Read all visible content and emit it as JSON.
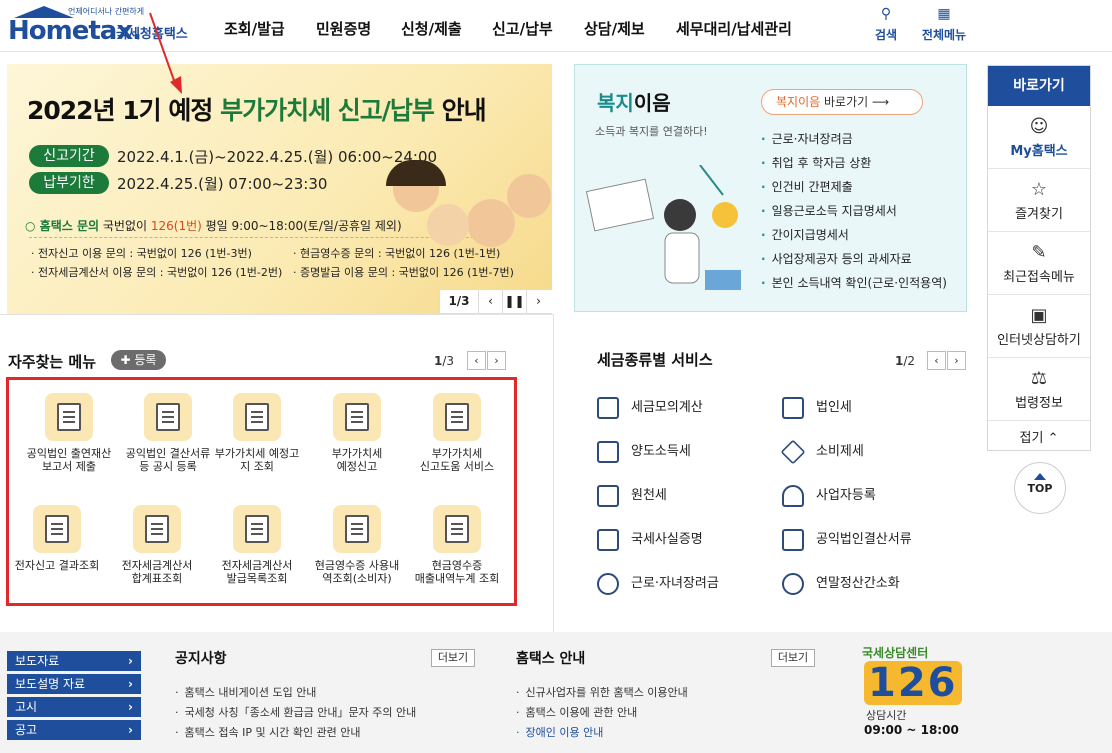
{
  "header": {
    "logo_main": "Hometax.",
    "logo_sub": "국세청홈택스",
    "logo_tiny": "언제어디서나 간편하게",
    "nav": [
      "조회/발급",
      "민원증명",
      "신청/제출",
      "신고/납부",
      "상담/제보",
      "세무대리/납세관리"
    ],
    "search_label": "검색",
    "allmenu_label": "전체메뉴"
  },
  "banner": {
    "title_prefix": "2022년 1기 예정 ",
    "title_highlight": "부가가치세 신고/납부",
    "title_suffix": " 안내",
    "period_label": "신고기간",
    "period_text": "2022.4.1.(금)~2022.4.25.(월) 06:00~24:00",
    "pay_label": "납부기한",
    "pay_text": "2022.4.25.(월) 07:00~23:30",
    "contact_brand": "홈택스 문의",
    "contact_a": "국번없이 ",
    "contact_num": "126(1번)",
    "contact_b": " 평일 9:00~18:00(토/일/공휴일 제외)",
    "line1_left": "· 전자신고 이용 문의 : 국번없이 126 (1번-3번)",
    "line1_right": "· 현금영수증 문의 : 국번없이 126 (1번-1번)",
    "line2_left": "· 전자세금계산서 이용 문의 : 국번없이 126 (1번-2번)",
    "line2_right": "· 증명발급 이용 문의 : 국번없이 126 (1번-7번)",
    "pager": "1/3"
  },
  "welfare": {
    "title_a": "복지",
    "title_b": "이음",
    "subtitle": "소득과 복지를 연결하다!",
    "go_a": "복지이음",
    "go_b": " 바로가기",
    "items": [
      "근로·자녀장려금",
      "취업 후 학자금 상환",
      "인건비 간편제출",
      "일용근로소득 지급명세서",
      "간이지급명세서",
      "사업장제공자 등의 과세자료",
      "본인 소득내역 확인(근로·인적용역)"
    ]
  },
  "quick": {
    "title": "바로가기",
    "items": [
      "My홈택스",
      "즐겨찾기",
      "최근접속메뉴",
      "인터넷상담하기",
      "법령정보"
    ],
    "fold": "접기",
    "top": "TOP"
  },
  "freq": {
    "title": "자주찾는 메뉴",
    "register": "등록",
    "pager_cur": "1",
    "pager_total": "/3",
    "items": [
      [
        "공익법인 출연재산",
        "보고서 제출"
      ],
      [
        "공익법인 결산서류",
        "등 공시 등록"
      ],
      [
        "부가가치세 예정고",
        "지 조회"
      ],
      [
        "부가가치세",
        "예정신고"
      ],
      [
        "부가가치세",
        "신고도움 서비스"
      ],
      [
        "전자신고 결과조회",
        ""
      ],
      [
        "전자세금계산서",
        "합계표조회"
      ],
      [
        "전자세금계산서",
        "발급목록조회"
      ],
      [
        "현금영수증 사용내",
        "역조회(소비자)"
      ],
      [
        "현금영수증",
        "매출내역누계 조회"
      ]
    ]
  },
  "tax": {
    "title": "세금종류별 서비스",
    "pager_cur": "1",
    "pager_total": "/2",
    "left": [
      "세금모의계산",
      "양도소득세",
      "원천세",
      "국세사실증명",
      "근로·자녀장려금"
    ],
    "right": [
      "법인세",
      "소비제세",
      "사업자등록",
      "공익법인결산서류",
      "연말정산간소화"
    ]
  },
  "footer": {
    "side_buttons": [
      "보도자료",
      "보도설명 자료",
      "고시",
      "공고"
    ],
    "notice_title": "공지사항",
    "notice_more": "더보기",
    "notice_items": [
      "홈택스 내비게이션 도입 안내",
      "국세청 사칭「종소세 환급금 안내」문자 주의 안내",
      "홈택스 접속 IP 및 시간 확인 관련 안내"
    ],
    "guide_title": "홈택스 안내",
    "guide_more": "더보기",
    "guide_items": [
      "신규사업자를 위한 홈택스 이용안내",
      "홈택스 이용에 관한 안내",
      "장애인 이용 안내"
    ],
    "center_top": "국세상담센터",
    "center_num": "126",
    "center_label": "상담시간",
    "center_time": "09:00 ~ 18:00"
  },
  "colors": {
    "brand": "#1f4e9c",
    "green": "#1c7a3a",
    "highlight_red": "#e02a2a"
  }
}
